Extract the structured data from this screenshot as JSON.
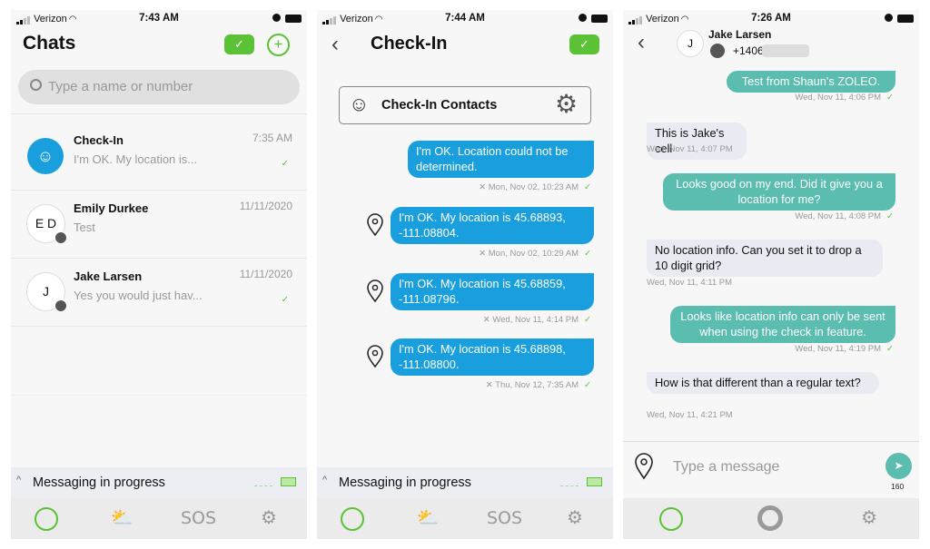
{
  "status": [
    {
      "carrier": "Verizon",
      "time": "7:43 AM"
    },
    {
      "carrier": "Verizon",
      "time": "7:44 AM"
    },
    {
      "carrier": "Verizon",
      "time": "7:26 AM"
    }
  ],
  "chats": {
    "title": "Chats",
    "search_placeholder": "Type a name or number",
    "rows": [
      {
        "name": "Check-In",
        "preview": "I'm OK. My location is...",
        "date": "7:35 AM",
        "delivered": true
      },
      {
        "name": "Emily Durkee",
        "preview": "Test",
        "date": "11/11/2020",
        "initials": "E D",
        "delivered": false
      },
      {
        "name": "Jake Larsen",
        "preview": "Yes you would just hav...",
        "date": "11/11/2020",
        "initials": "J",
        "delivered": true
      }
    ]
  },
  "checkin": {
    "title": "Check-In",
    "contacts_label": "Check-In Contacts",
    "messages": [
      {
        "text": "I'm OK. Location could not be determined.",
        "time": "Mon, Nov 02, 10:23 AM",
        "pin": false
      },
      {
        "text": "I'm OK. My location is 45.68893, -111.08804.",
        "time": "Mon, Nov 02, 10:29 AM",
        "pin": true
      },
      {
        "text": "I'm OK. My location is 45.68859, -111.08796.",
        "time": "Wed, Nov 11, 4:14 PM",
        "pin": true
      },
      {
        "text": "I'm OK. My location is 45.68898, -111.08800.",
        "time": "Thu, Nov 12, 7:35 AM",
        "pin": true
      }
    ]
  },
  "conversation": {
    "contact_name": "Jake Larsen",
    "initials": "J",
    "phone": "+1406",
    "messages": [
      {
        "dir": "out",
        "text": "Test from Shaun's ZOLEO.",
        "time": "Wed, Nov 11, 4:06 PM"
      },
      {
        "dir": "in",
        "text": "This is Jake's cell",
        "time": "Wed, Nov 11, 4:07 PM"
      },
      {
        "dir": "out",
        "text": "Looks good on my end. Did it give you a location for me?",
        "time": "Wed, Nov 11, 4:08 PM"
      },
      {
        "dir": "in",
        "text": "No location info. Can you set it to drop a 10 digit grid?",
        "time": "Wed, Nov 11, 4:11 PM"
      },
      {
        "dir": "out",
        "text": "Looks like location info can only be sent when using the check in feature.",
        "time": "Wed, Nov 11, 4:19 PM"
      },
      {
        "dir": "in",
        "text": "How is that different than a regular text?",
        "time": "Wed, Nov 11, 4:21 PM"
      }
    ],
    "input_placeholder": "Type a message",
    "char_count": "160"
  },
  "messaging_status": "Messaging in progress",
  "tabs": {
    "sos": "SOS"
  },
  "colors": {
    "green": "#5bc236",
    "blue": "#1a9fde",
    "teal": "#5bbcb0"
  }
}
